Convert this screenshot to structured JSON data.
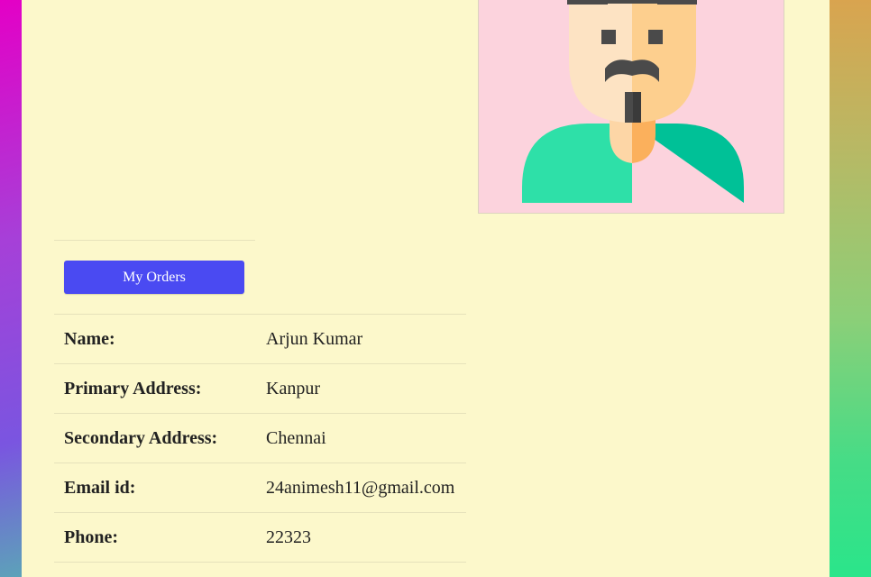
{
  "profile": {
    "orders_button": "My Orders",
    "fields": [
      {
        "label": "Name:",
        "value": "Arjun Kumar"
      },
      {
        "label": "Primary Address:",
        "value": "Kanpur"
      },
      {
        "label": "Secondary Address:",
        "value": "Chennai"
      },
      {
        "label": "Email id:",
        "value": "24animesh11@gmail.com"
      },
      {
        "label": "Phone:",
        "value": "22323"
      }
    ],
    "avatar_icon": "man-avatar-icon"
  },
  "colors": {
    "panel_bg": "#fcf8cb",
    "button_bg": "#4a4af2",
    "avatar_bg": "#fcd3dd"
  }
}
